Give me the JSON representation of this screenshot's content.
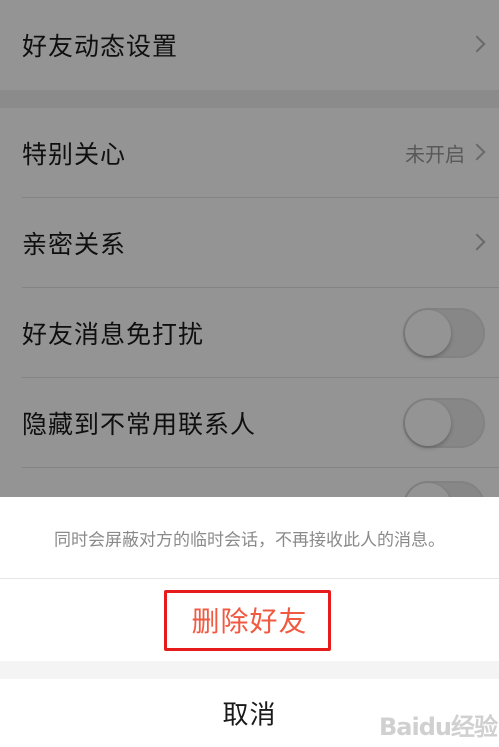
{
  "settings": {
    "friend_feed": {
      "label": "好友动态设置"
    },
    "special_care": {
      "label": "特别关心",
      "status": "未开启"
    },
    "close_relationship": {
      "label": "亲密关系"
    },
    "do_not_disturb": {
      "label": "好友消息免打扰",
      "enabled": false
    },
    "hide_to_rare": {
      "label": "隐藏到不常用联系人",
      "enabled": false
    }
  },
  "action_sheet": {
    "message": "同时会屏蔽对方的临时会话，不再接收此人的消息。",
    "delete_label": "删除好友",
    "cancel_label": "取消"
  },
  "colors": {
    "delete_text": "#f05a41",
    "highlight_border": "#e61b1b"
  },
  "watermark": {
    "text": "Baidu经验"
  }
}
